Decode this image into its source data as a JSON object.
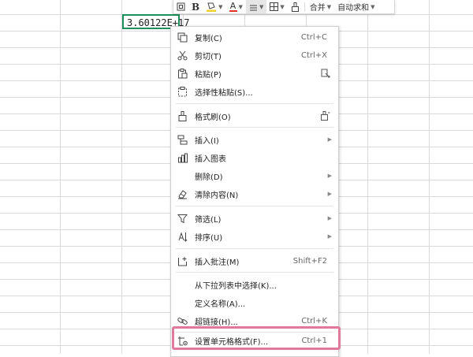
{
  "cell": {
    "value": "3.60122E+17"
  },
  "toolbar": {
    "bold_label": "B",
    "font_color_label": "A",
    "merge_label": "合并",
    "autosum_label": "自动求和"
  },
  "menu": {
    "copy": {
      "label": "复制(C)",
      "shortcut": "Ctrl+C"
    },
    "cut": {
      "label": "剪切(T)",
      "shortcut": "Ctrl+X"
    },
    "paste": {
      "label": "粘贴(P)"
    },
    "paste_special": {
      "label": "选择性粘贴(S)..."
    },
    "format_painter": {
      "label": "格式刷(O)"
    },
    "insert": {
      "label": "插入(I)"
    },
    "insert_chart": {
      "label": "插入图表"
    },
    "delete": {
      "label": "删除(D)"
    },
    "clear": {
      "label": "清除内容(N)"
    },
    "filter": {
      "label": "筛选(L)"
    },
    "sort": {
      "label": "排序(U)"
    },
    "insert_comment": {
      "label": "插入批注(M)",
      "shortcut": "Shift+F2"
    },
    "pick_from_list": {
      "label": "从下拉列表中选择(K)..."
    },
    "define_name": {
      "label": "定义名称(A)..."
    },
    "hyperlink": {
      "label": "超链接(H)...",
      "shortcut": "Ctrl+K"
    },
    "format_cells": {
      "label": "设置单元格格式(F)...",
      "shortcut": "Ctrl+1"
    }
  },
  "colors": {
    "selection_border": "#1f8f5c",
    "highlight_box": "#e07a9a",
    "font_color_bar": "#e0302a",
    "fill_color_bar": "#f2d027"
  }
}
